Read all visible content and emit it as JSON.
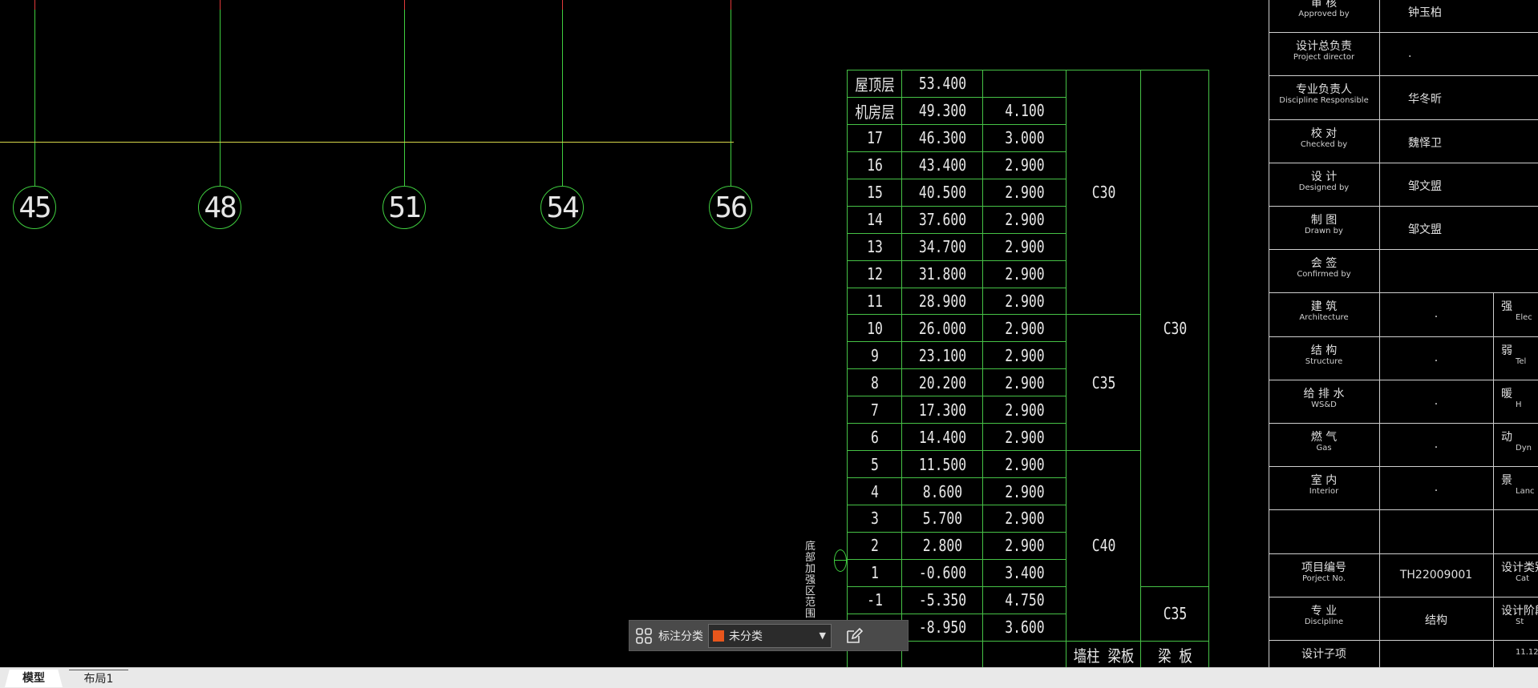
{
  "grid_axes": [
    {
      "label": "45"
    },
    {
      "label": "48"
    },
    {
      "label": "51"
    },
    {
      "label": "54"
    },
    {
      "label": "56"
    }
  ],
  "floor_table": {
    "rows": [
      {
        "floor": "屋顶层",
        "elevation": "53.400",
        "height": ""
      },
      {
        "floor": "机房层",
        "elevation": "49.300",
        "height": "4.100"
      },
      {
        "floor": "17",
        "elevation": "46.300",
        "height": "3.000"
      },
      {
        "floor": "16",
        "elevation": "43.400",
        "height": "2.900"
      },
      {
        "floor": "15",
        "elevation": "40.500",
        "height": "2.900"
      },
      {
        "floor": "14",
        "elevation": "37.600",
        "height": "2.900"
      },
      {
        "floor": "13",
        "elevation": "34.700",
        "height": "2.900"
      },
      {
        "floor": "12",
        "elevation": "31.800",
        "height": "2.900"
      },
      {
        "floor": "11",
        "elevation": "28.900",
        "height": "2.900"
      },
      {
        "floor": "10",
        "elevation": "26.000",
        "height": "2.900"
      },
      {
        "floor": "9",
        "elevation": "23.100",
        "height": "2.900"
      },
      {
        "floor": "8",
        "elevation": "20.200",
        "height": "2.900"
      },
      {
        "floor": "7",
        "elevation": "17.300",
        "height": "2.900"
      },
      {
        "floor": "6",
        "elevation": "14.400",
        "height": "2.900"
      },
      {
        "floor": "5",
        "elevation": "11.500",
        "height": "2.900"
      },
      {
        "floor": "4",
        "elevation": "8.600",
        "height": "2.900"
      },
      {
        "floor": "3",
        "elevation": "5.700",
        "height": "2.900"
      },
      {
        "floor": "2",
        "elevation": "2.800",
        "height": "2.900"
      },
      {
        "floor": "1",
        "elevation": "-0.600",
        "height": "3.400"
      },
      {
        "floor": "-1",
        "elevation": "-5.350",
        "height": "4.750"
      },
      {
        "floor": "",
        "elevation": "-8.950",
        "height": "3.600"
      }
    ],
    "concrete_wall_col": [
      "C30",
      "C35",
      "C40"
    ],
    "concrete_beam_slab": [
      "C30",
      "C35"
    ],
    "footer_col4": "墙柱 梁板",
    "footer_col5": "梁 板",
    "side_label": "底部加强区范围"
  },
  "title_block": {
    "rows": [
      {
        "cn": "审 核",
        "en": "Approved by",
        "value": "钟玉柏"
      },
      {
        "cn": "设计总负责",
        "en": "Project director",
        "value": "."
      },
      {
        "cn": "专业负责人",
        "en": "Discipline Responsible",
        "value": "华冬昕"
      },
      {
        "cn": "校 对",
        "en": "Checked by",
        "value": "魏怿卫"
      },
      {
        "cn": "设 计",
        "en": "Designed by",
        "value": "邹文盟"
      },
      {
        "cn": "制 图",
        "en": "Drawn by",
        "value": "邹文盟"
      },
      {
        "cn": "会 签",
        "en": "Confirmed by",
        "value": ""
      },
      {
        "cn": "建 筑",
        "en": "Architecture",
        "value": "."
      },
      {
        "cn": "结 构",
        "en": "Structure",
        "value": "."
      },
      {
        "cn": "给 排 水",
        "en": "WS&D",
        "value": "."
      },
      {
        "cn": "燃 气",
        "en": "Gas",
        "value": "."
      },
      {
        "cn": "室 内",
        "en": "Interior",
        "value": "."
      },
      {
        "cn": "",
        "en": "",
        "value": ""
      },
      {
        "cn": "项目编号",
        "en": "Porject No.",
        "value": "TH22009001"
      },
      {
        "cn": "专 业",
        "en": "Discipline",
        "value": "结构"
      },
      {
        "cn": "设计子项",
        "en": "",
        "value": ""
      }
    ],
    "right_col": [
      {
        "cn": "强",
        "en": "Elec"
      },
      {
        "cn": "弱",
        "en": "Tel"
      },
      {
        "cn": "暖",
        "en": "H"
      },
      {
        "cn": "动",
        "en": "Dyn"
      },
      {
        "cn": "景",
        "en": "Lanc"
      },
      {
        "cn": "",
        "en": ""
      },
      {
        "cn": "设计类别",
        "en": "Cat"
      },
      {
        "cn": "设计阶段",
        "en": "St"
      },
      {
        "cn": "",
        "en": "11.12"
      }
    ]
  },
  "float_toolbar": {
    "label": "标注分类",
    "selected": "未分类",
    "swatch_color": "#e8561c"
  },
  "tabs": {
    "model": "模型",
    "layout1": "布局1"
  }
}
